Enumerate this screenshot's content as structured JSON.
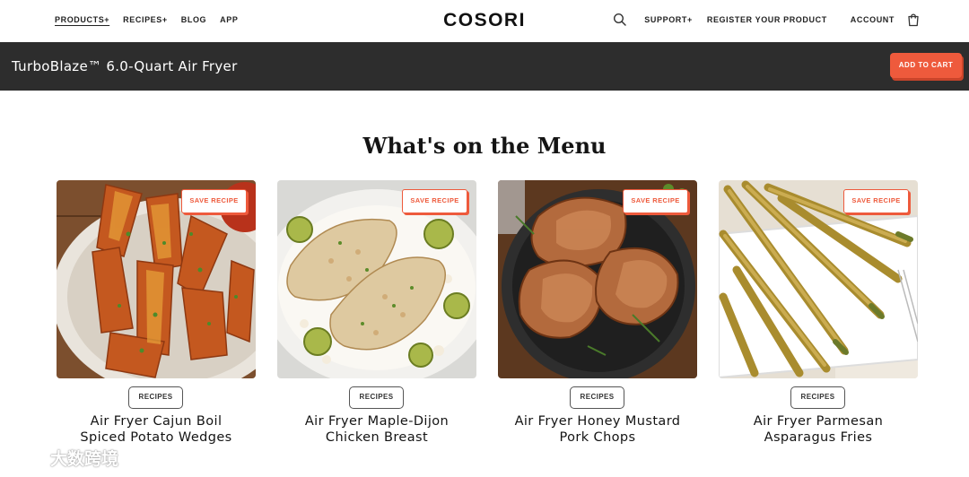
{
  "nav": {
    "left_items": [
      "PRODUCTS+",
      "RECIPES+",
      "BLOG",
      "APP"
    ],
    "logo": "COSORI",
    "right_items": [
      "SUPPORT+",
      "REGISTER YOUR PRODUCT"
    ],
    "account": "ACCOUNT",
    "icons": [
      "search-icon",
      "cart-icon"
    ]
  },
  "product_bar": {
    "title": "TurboBlaze™ 6.0-Quart Air Fryer",
    "add_to_cart": "ADD TO CART"
  },
  "menu": {
    "title": "What's on the Menu",
    "save_label": "SAVE RECIPE",
    "cards": [
      {
        "tag": "RECIPES",
        "title_line1": "Air Fryer Cajun Boil",
        "title_line2": "Spiced Potato Wedges"
      },
      {
        "tag": "RECIPES",
        "title_line1": "Air Fryer Maple-Dijon",
        "title_line2": "Chicken Breast"
      },
      {
        "tag": "RECIPES",
        "title_line1": "Air Fryer Honey Mustard",
        "title_line2": "Pork Chops"
      },
      {
        "tag": "RECIPES",
        "title_line1": "Air Fryer Parmesan",
        "title_line2": "Asparagus Fries"
      }
    ]
  },
  "watermark": {
    "text": "大数跨境"
  },
  "colors": {
    "accent": "#ee5a3c",
    "bar": "#2d2d2d",
    "text": "#141414"
  }
}
